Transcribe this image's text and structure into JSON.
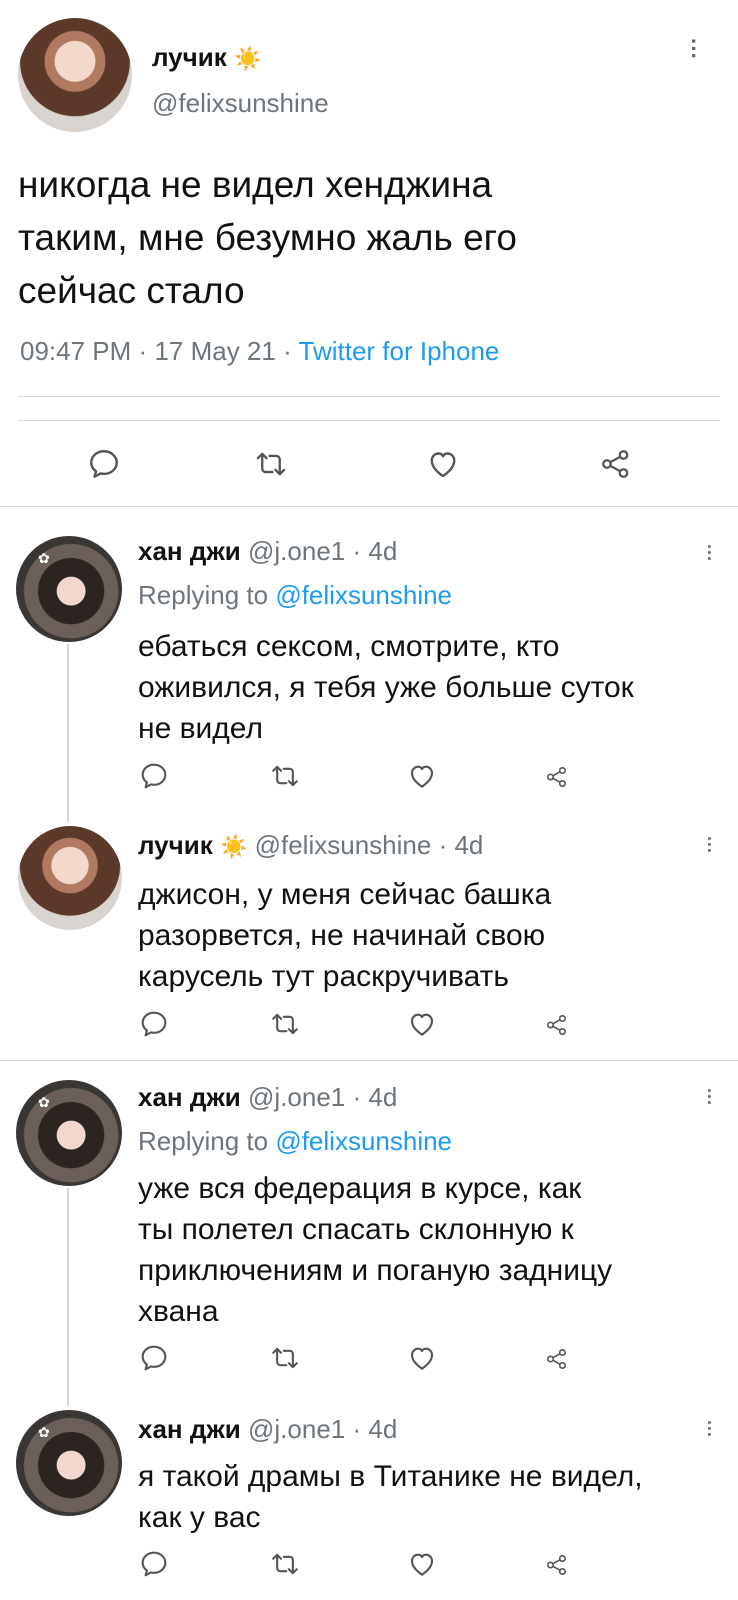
{
  "main_tweet": {
    "display_name": "лучик",
    "handle": "@felixsunshine",
    "text_lines": [
      "никогда не видел хенджина",
      "таким, мне безумно жаль его",
      "сейчас стало"
    ],
    "time": "09:47 PM",
    "date": "17 May 21",
    "source": "Twitter for Iphone",
    "sun_emoji": "☀️"
  },
  "replies": [
    {
      "display_name": "хан джи",
      "handle": "@j.one1",
      "age": "4d",
      "replying_prefix": "Replying to",
      "replying_to": "@felixsunshine",
      "text_lines": [
        "ебаться сексом, смотрите, кто",
        "оживился, я тебя уже больше суток",
        "не видел"
      ]
    },
    {
      "display_name": "лучик",
      "handle": "@felixsunshine",
      "age": "4d",
      "text_lines": [
        "джисон, у меня сейчас башка",
        "разорвется, не начинай свою",
        "карусель тут раскручивать"
      ]
    },
    {
      "display_name": "хан джи",
      "handle": "@j.one1",
      "age": "4d",
      "replying_prefix": "Replying to",
      "replying_to": "@felixsunshine",
      "text_lines": [
        "уже вся федерация в курсе, как",
        "ты полетел спасать склонную к",
        "приключениям и поганую задницу",
        "хвана"
      ]
    },
    {
      "display_name": "хан джи",
      "handle": "@j.one1",
      "age": "4d",
      "text_lines": [
        "я такой драмы в Титанике не видел,",
        "как у вас"
      ]
    }
  ],
  "separators": {
    "dot": "·"
  },
  "icons": {
    "reply": "reply-icon",
    "retweet": "retweet-icon",
    "like": "heart-icon",
    "share": "share-icon",
    "more": "more-icon"
  },
  "colors": {
    "link": "#1d9bf0",
    "secondary": "#6e767d",
    "sun": "#f5b301"
  }
}
